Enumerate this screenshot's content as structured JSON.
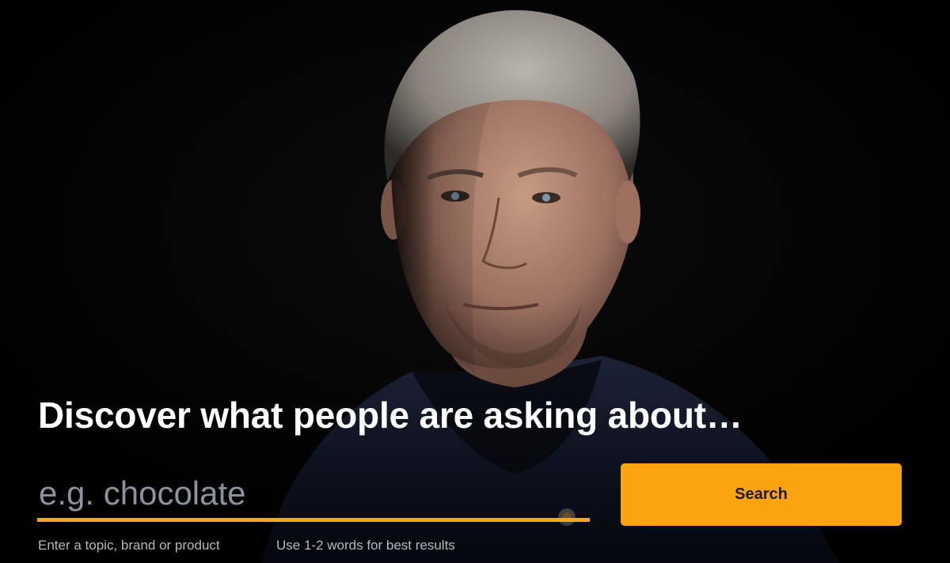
{
  "hero": {
    "background_color": "#020202",
    "accent_color": "#fca40f",
    "portrait_description_icon": "portrait-photo"
  },
  "headline": "Discover what people are asking about…",
  "search": {
    "placeholder": "e.g. chocolate",
    "value": "",
    "button_label": "Search"
  },
  "hints": {
    "topic": "Enter a topic, brand or product",
    "words": "Use 1-2 words for best results"
  }
}
